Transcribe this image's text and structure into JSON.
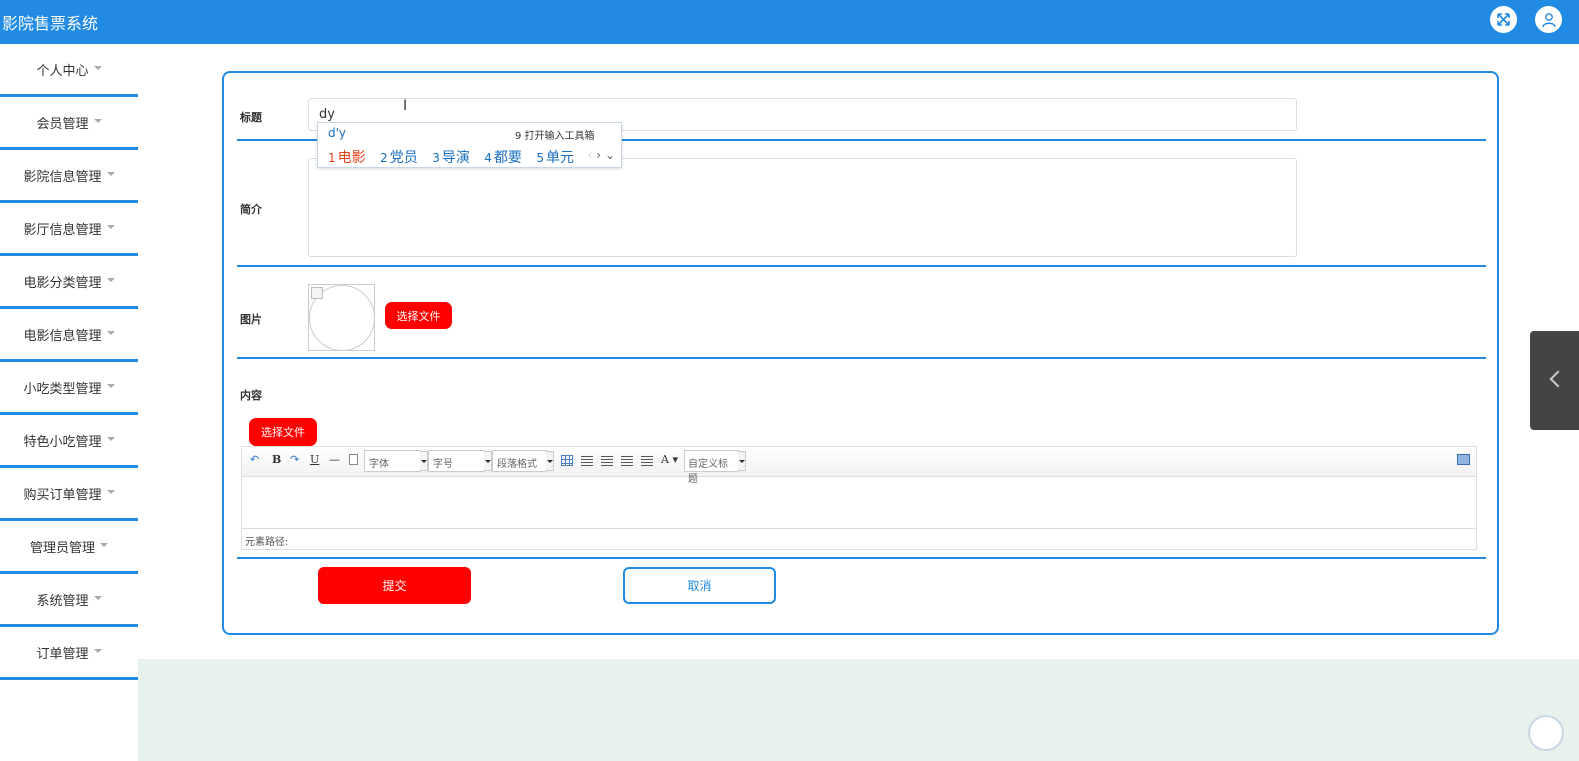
{
  "app": {
    "title": "影院售票系统"
  },
  "header": {
    "icons": [
      "expand-icon",
      "user-icon"
    ]
  },
  "sidebar": {
    "items": [
      {
        "label": "个人中心"
      },
      {
        "label": "会员管理"
      },
      {
        "label": "影院信息管理"
      },
      {
        "label": "影厅信息管理"
      },
      {
        "label": "电影分类管理"
      },
      {
        "label": "电影信息管理"
      },
      {
        "label": "小吃类型管理"
      },
      {
        "label": "特色小吃管理"
      },
      {
        "label": "购买订单管理"
      },
      {
        "label": "管理员管理"
      },
      {
        "label": "系统管理"
      },
      {
        "label": "订单管理"
      }
    ]
  },
  "form": {
    "title_label": "标题",
    "title_value": "dy",
    "intro_label": "简介",
    "intro_value": "",
    "image_label": "图片",
    "image_button": "选择文件",
    "content_label": "内容",
    "content_button": "选择文件",
    "submit_label": "提交",
    "cancel_label": "取消"
  },
  "editor": {
    "font_select": "字体",
    "size_select": "字号",
    "paragraph_select": "段落格式",
    "custom_heading_select": "自定义标题",
    "status_text": "元素路径:"
  },
  "ime": {
    "composition": "d'y",
    "hint_number": "9",
    "hint_text": "打开输入工具箱",
    "candidates": [
      {
        "num": "1",
        "text": "电影"
      },
      {
        "num": "2",
        "text": "党员"
      },
      {
        "num": "3",
        "text": "导演"
      },
      {
        "num": "4",
        "text": "都要"
      },
      {
        "num": "5",
        "text": "单元"
      }
    ]
  },
  "colors": {
    "primary": "#218ae3",
    "danger": "#ff0000",
    "ime_selected": "#e2451b",
    "bottom_bg": "#e8f2ed"
  }
}
